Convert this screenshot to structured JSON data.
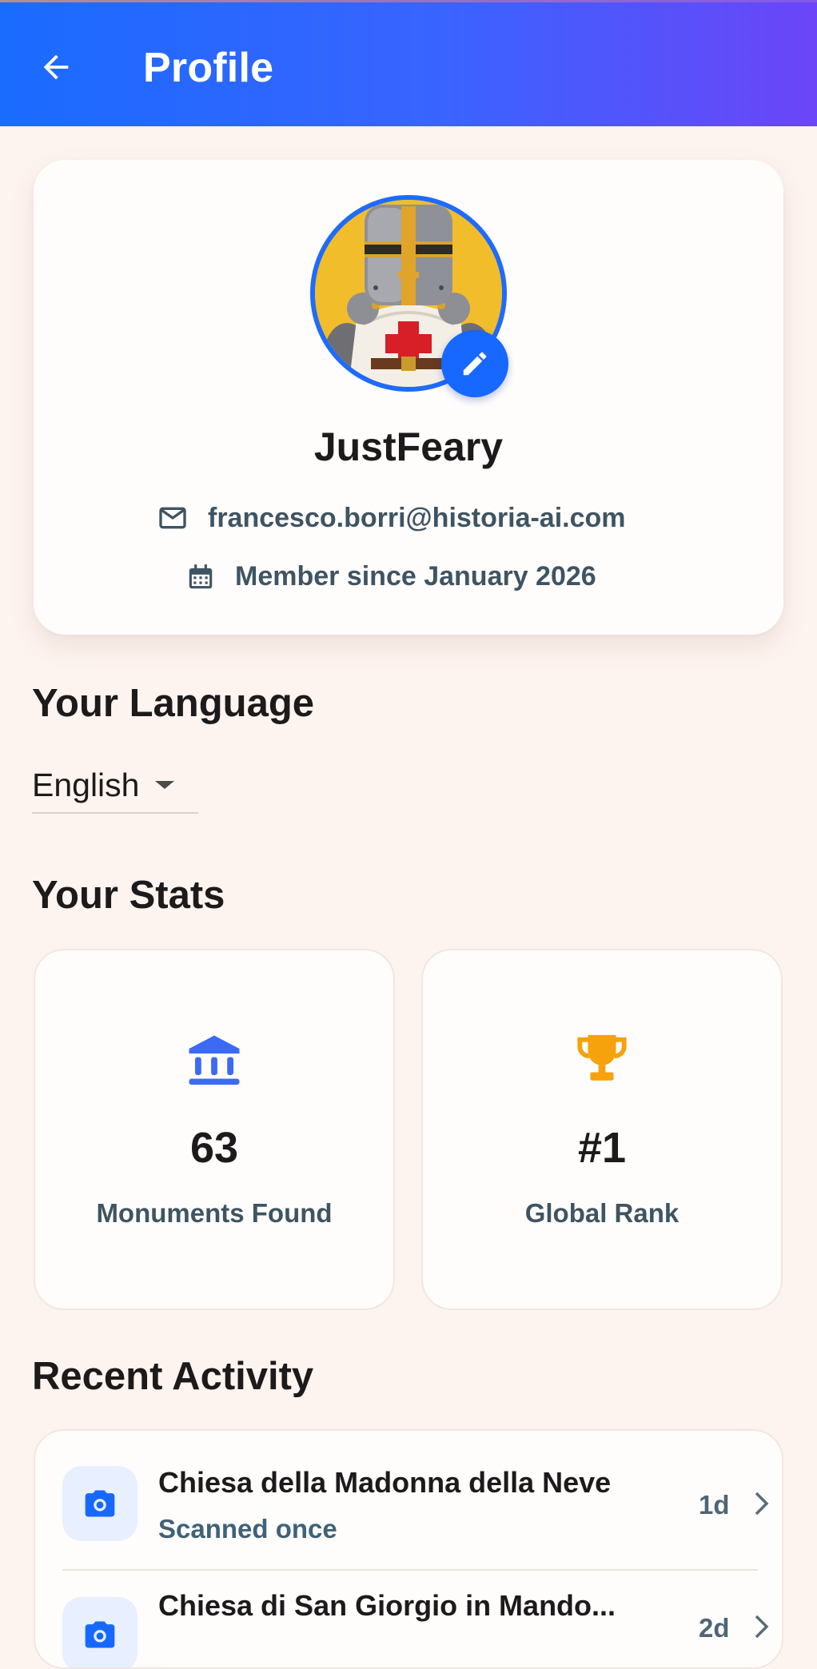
{
  "app_bar": {
    "title": "Profile",
    "back_icon": "arrow-left-icon"
  },
  "profile": {
    "username": "JustFeary",
    "email": "francesco.borri@historia-ai.com",
    "member_since": "Member since January 2026",
    "avatar_icon": "crusader-knight-avatar",
    "edit_icon": "pencil-icon"
  },
  "language": {
    "section_title": "Your Language",
    "selected": "English"
  },
  "stats": {
    "section_title": "Your Stats",
    "items": [
      {
        "value": "63",
        "label": "Monuments Found",
        "icon": "museum-icon",
        "color": "#3b6af5"
      },
      {
        "value": "#1",
        "label": "Global Rank",
        "icon": "trophy-icon",
        "color": "#f5a20d"
      }
    ]
  },
  "activity": {
    "section_title": "Recent Activity",
    "items": [
      {
        "title": "Chiesa della Madonna della Neve",
        "subtitle": "Scanned once",
        "time": "1d",
        "icon": "camera-icon"
      },
      {
        "title": "Chiesa di San Giorgio in Mando...",
        "subtitle": "",
        "time": "2d",
        "icon": "camera-icon"
      }
    ]
  },
  "colors": {
    "accent": "#1668ff",
    "background": "#fdf3ef",
    "card": "#fffdfc"
  }
}
